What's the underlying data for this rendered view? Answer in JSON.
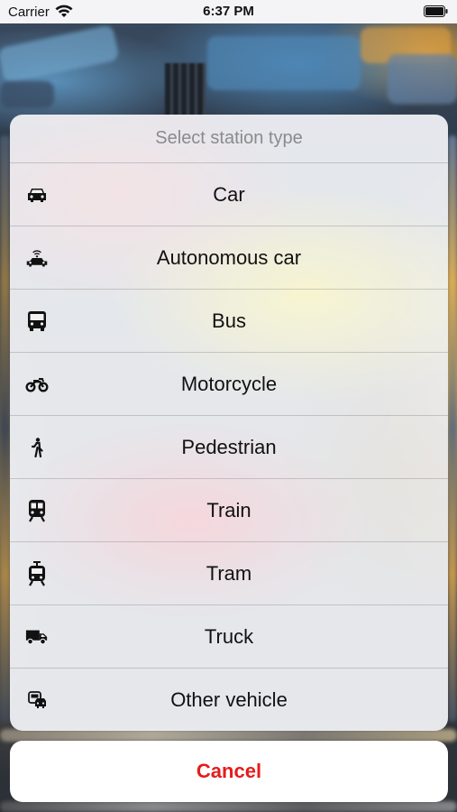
{
  "status_bar": {
    "carrier": "Carrier",
    "time": "6:37 PM"
  },
  "action_sheet": {
    "title": "Select station type",
    "options": [
      {
        "label": "Car",
        "icon": "car-icon"
      },
      {
        "label": "Autonomous car",
        "icon": "autonomous-car-icon"
      },
      {
        "label": "Bus",
        "icon": "bus-icon"
      },
      {
        "label": "Motorcycle",
        "icon": "motorcycle-icon"
      },
      {
        "label": "Pedestrian",
        "icon": "pedestrian-icon"
      },
      {
        "label": "Train",
        "icon": "train-icon"
      },
      {
        "label": "Tram",
        "icon": "tram-icon"
      },
      {
        "label": "Truck",
        "icon": "truck-icon"
      },
      {
        "label": "Other vehicle",
        "icon": "other-vehicle-icon"
      }
    ],
    "cancel_label": "Cancel"
  },
  "colors": {
    "cancel_text": "#e61b1b",
    "title_text": "#8a8a8e"
  }
}
